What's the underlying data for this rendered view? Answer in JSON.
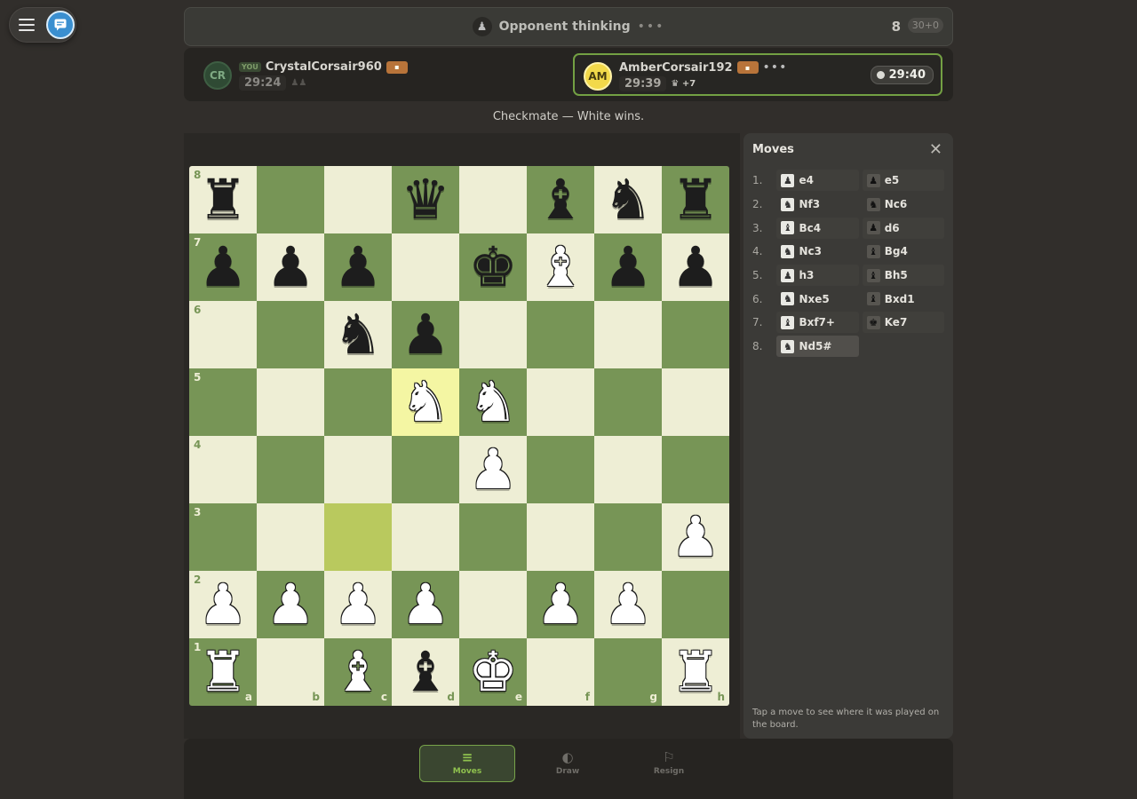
{
  "status": {
    "text": "Opponent thinking",
    "move_number": "8",
    "time_control": "30+0"
  },
  "players": {
    "you": {
      "badge": "YOU",
      "initials": "CR",
      "name": "CrystalCorsair960",
      "clock": "29:24",
      "extra": "♟♟"
    },
    "opponent": {
      "initials": "AM",
      "name": "AmberCorsair192",
      "clock": "29:39",
      "material": "+7",
      "active_clock": "29:40"
    }
  },
  "result": "Checkmate — White wins.",
  "board": {
    "ranks": [
      "8",
      "7",
      "6",
      "5",
      "4",
      "3",
      "2",
      "1"
    ],
    "files": [
      "a",
      "b",
      "c",
      "d",
      "e",
      "f",
      "g",
      "h"
    ],
    "rows": [
      [
        "bR",
        "",
        "",
        "bQ",
        "",
        "bB",
        "bN",
        "bR"
      ],
      [
        "bP",
        "bP",
        "bP",
        "",
        "bK",
        "wB",
        "bP",
        "bP"
      ],
      [
        "",
        "",
        "bN",
        "bP",
        "",
        "",
        "",
        ""
      ],
      [
        "",
        "",
        "",
        "wN",
        "wN",
        "",
        "",
        ""
      ],
      [
        "",
        "",
        "",
        "",
        "wP",
        "",
        "",
        ""
      ],
      [
        "",
        "",
        "",
        "",
        "",
        "",
        "",
        "wP"
      ],
      [
        "wP",
        "wP",
        "wP",
        "wP",
        "",
        "wP",
        "wP",
        ""
      ],
      [
        "wR",
        "",
        "wB",
        "bB",
        "wK",
        "",
        "",
        "wR"
      ]
    ],
    "highlights": [
      "d5",
      "c3"
    ]
  },
  "moves_panel": {
    "title": "Moves",
    "hint": "Tap a move to see where it was played on the board.",
    "moves": [
      {
        "num": "1.",
        "white": "e4",
        "wp": "P",
        "black": "e5",
        "bp": "P"
      },
      {
        "num": "2.",
        "white": "Nf3",
        "wp": "N",
        "black": "Nc6",
        "bp": "N"
      },
      {
        "num": "3.",
        "white": "Bc4",
        "wp": "B",
        "black": "d6",
        "bp": "P"
      },
      {
        "num": "4.",
        "white": "Nc3",
        "wp": "N",
        "black": "Bg4",
        "bp": "B"
      },
      {
        "num": "5.",
        "white": "h3",
        "wp": "P",
        "black": "Bh5",
        "bp": "B"
      },
      {
        "num": "6.",
        "white": "Nxe5",
        "wp": "N",
        "black": "Bxd1",
        "bp": "B"
      },
      {
        "num": "7.",
        "white": "Bxf7+",
        "wp": "B",
        "black": "Ke7",
        "bp": "K"
      },
      {
        "num": "8.",
        "white": "Nd5#",
        "wp": "N",
        "black": "",
        "bp": ""
      }
    ]
  },
  "toolbar": {
    "moves_label": "Moves",
    "draw_label": "Draw",
    "resign_label": "Resign"
  },
  "colors": {
    "light_square": "#eeeed5",
    "dark_square": "#779556",
    "highlight_light": "#f4f6a3",
    "highlight_dark": "#b9c95e",
    "accent": "#77a34a"
  }
}
